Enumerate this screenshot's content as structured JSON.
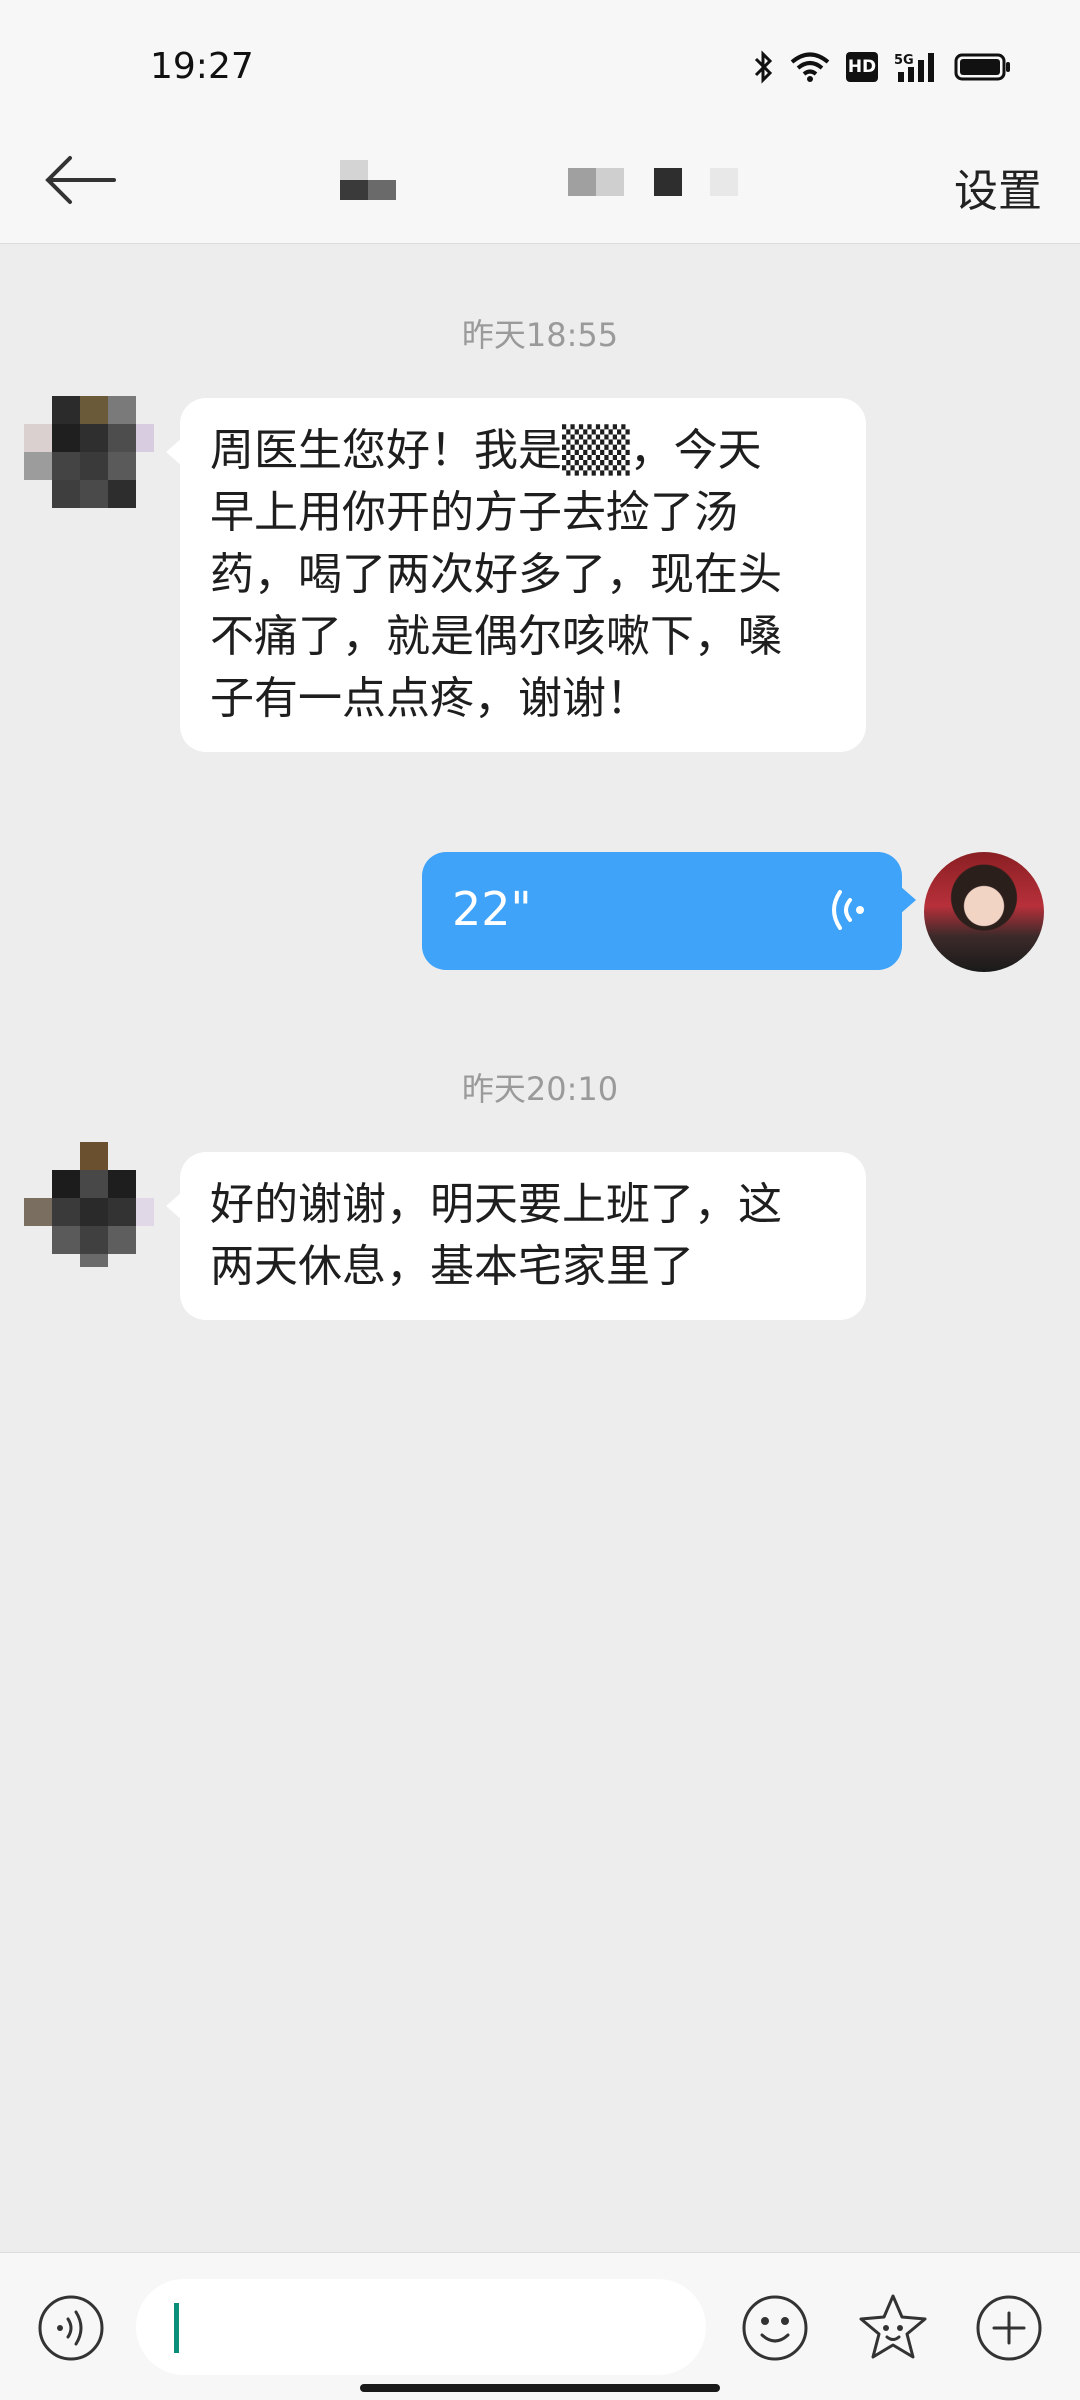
{
  "status_bar": {
    "time": "19:27",
    "hd_label": "HD",
    "network_label": "5G"
  },
  "header": {
    "back_icon": "back-arrow-icon",
    "settings_label": "设置"
  },
  "messages": [
    {
      "timestamp": "昨天18:55",
      "lines": [
        "周医生您好！我是▒▒，今天",
        "早上用你开的方子去捡了汤",
        "药，喝了两次好多了，现在头",
        "不痛了，就是偶尔咳嗽下，嗓",
        "子有一点点疼，谢谢！"
      ]
    },
    {
      "voice_duration": "22\"",
      "voice_icon": "voice-wave-icon"
    },
    {
      "timestamp": "昨天20:10",
      "lines": [
        "好的谢谢，明天要上班了，这",
        "两天休息，基本宅家里了"
      ]
    }
  ],
  "input_bar": {
    "icons": [
      "voice-input-icon",
      "emoji-icon",
      "sticker-icon",
      "plus-icon"
    ],
    "value": ""
  },
  "colors": {
    "chat_background": "#ededed",
    "voice_bubble": "#3ea3f9",
    "caret": "#0b8f7b"
  }
}
